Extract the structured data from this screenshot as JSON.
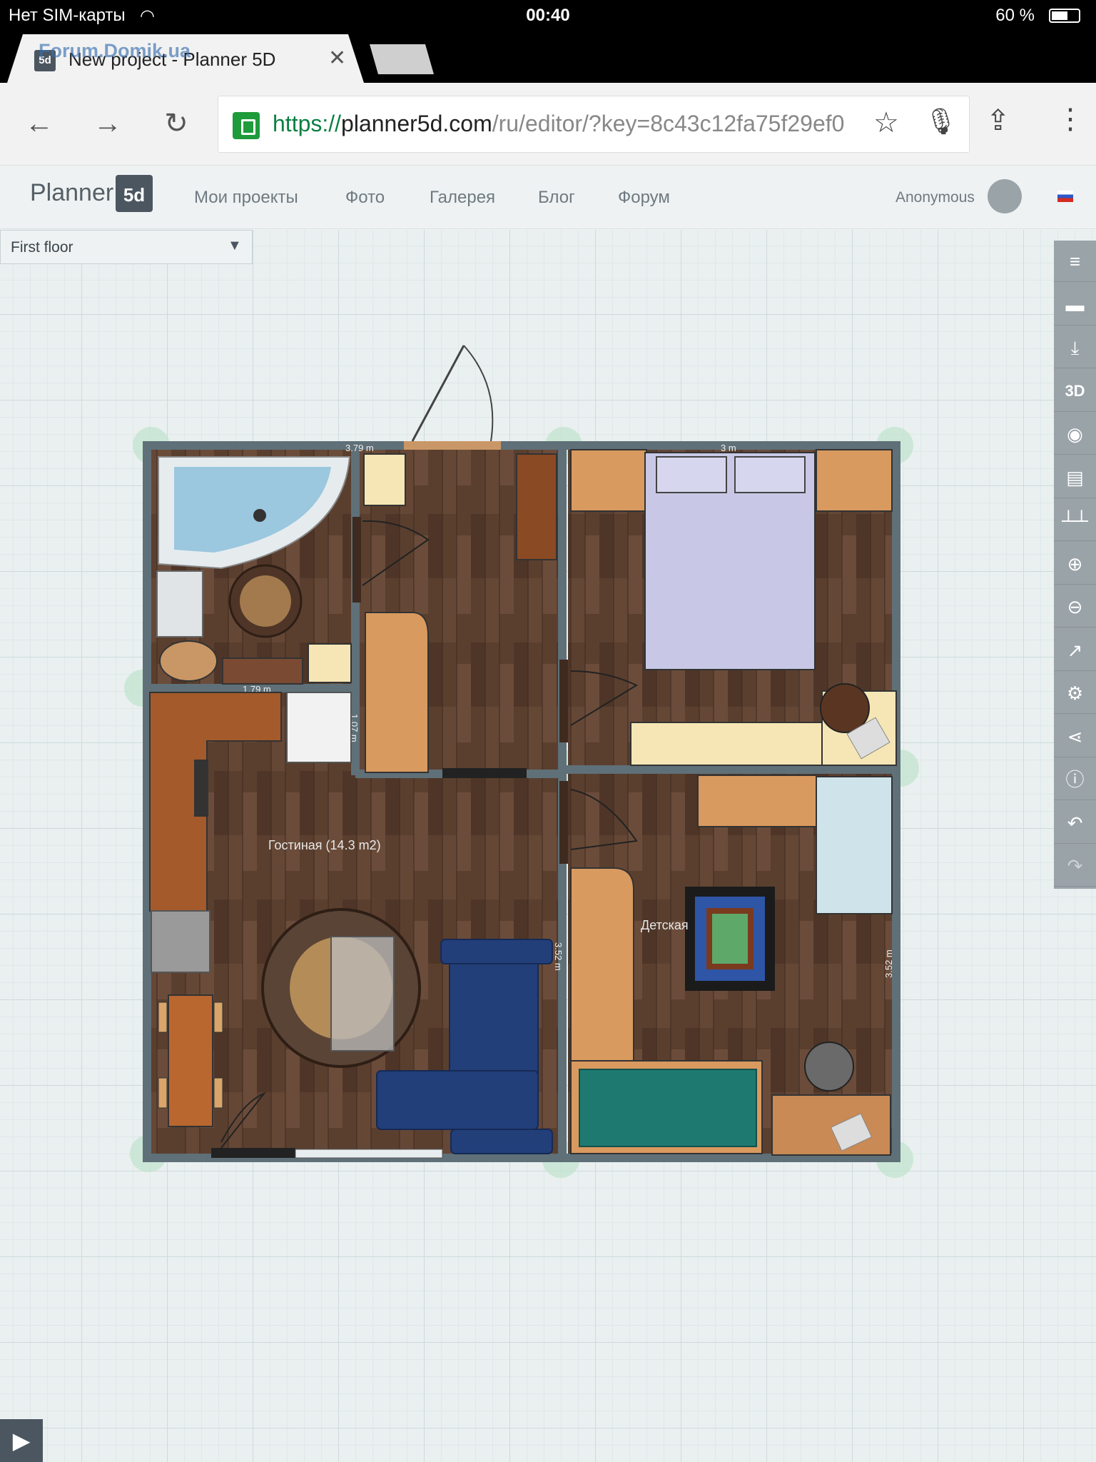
{
  "status_bar": {
    "carrier": "Нет SIM-карты",
    "time": "00:40",
    "battery": "60 %",
    "battery_level": 0.6
  },
  "browser": {
    "tab_title": "New project - Planner 5D",
    "tab_favicon": "5d",
    "tab_watermark": "Forum.Domik.ua",
    "url_scheme": "https://",
    "url_host": "planner5d.com",
    "url_path": "/ru/editor/?key=8c43c12fa75f29ef0"
  },
  "app": {
    "logo_text": "Planner",
    "logo_mark": "5d",
    "nav": [
      "Мои проекты",
      "Фото",
      "Галерея",
      "Блог",
      "Форум"
    ],
    "user": "Anonymous",
    "floor_selector": "First floor"
  },
  "sidebar": {
    "buttons": [
      {
        "icon": "menu-icon",
        "glyph": "≡"
      },
      {
        "icon": "folder-icon",
        "glyph": "▬"
      },
      {
        "icon": "download-icon",
        "glyph": "⤓"
      },
      {
        "icon": "3d-icon",
        "glyph": "3D"
      },
      {
        "icon": "camera-icon",
        "glyph": "◉"
      },
      {
        "icon": "print-icon",
        "glyph": "▤"
      },
      {
        "icon": "ruler-icon",
        "glyph": "┴┴"
      },
      {
        "icon": "zoom-in-icon",
        "glyph": "⊕"
      },
      {
        "icon": "zoom-out-icon",
        "glyph": "⊖"
      },
      {
        "icon": "external-link-icon",
        "glyph": "↗"
      },
      {
        "icon": "settings-icon",
        "glyph": "⚙"
      },
      {
        "icon": "share-icon",
        "glyph": "⋖"
      },
      {
        "icon": "info-icon",
        "glyph": "ⓘ"
      },
      {
        "icon": "undo-icon",
        "glyph": "↶"
      },
      {
        "icon": "redo-icon",
        "glyph": "↷"
      }
    ]
  },
  "floor_plan": {
    "rooms": [
      {
        "name": "Гостиная (14.3 m2)"
      },
      {
        "name": "Детская"
      }
    ],
    "dimensions": [
      "3.79 m",
      "3 m",
      "1.79 m",
      "3.52 m",
      "3.52 m",
      "1.07 m"
    ]
  },
  "colors": {
    "wall": "#5f7078",
    "floor_wood": "#5a3f2f",
    "sidebar": "#9aa3a8",
    "lock_green": "#1e9b3b"
  }
}
